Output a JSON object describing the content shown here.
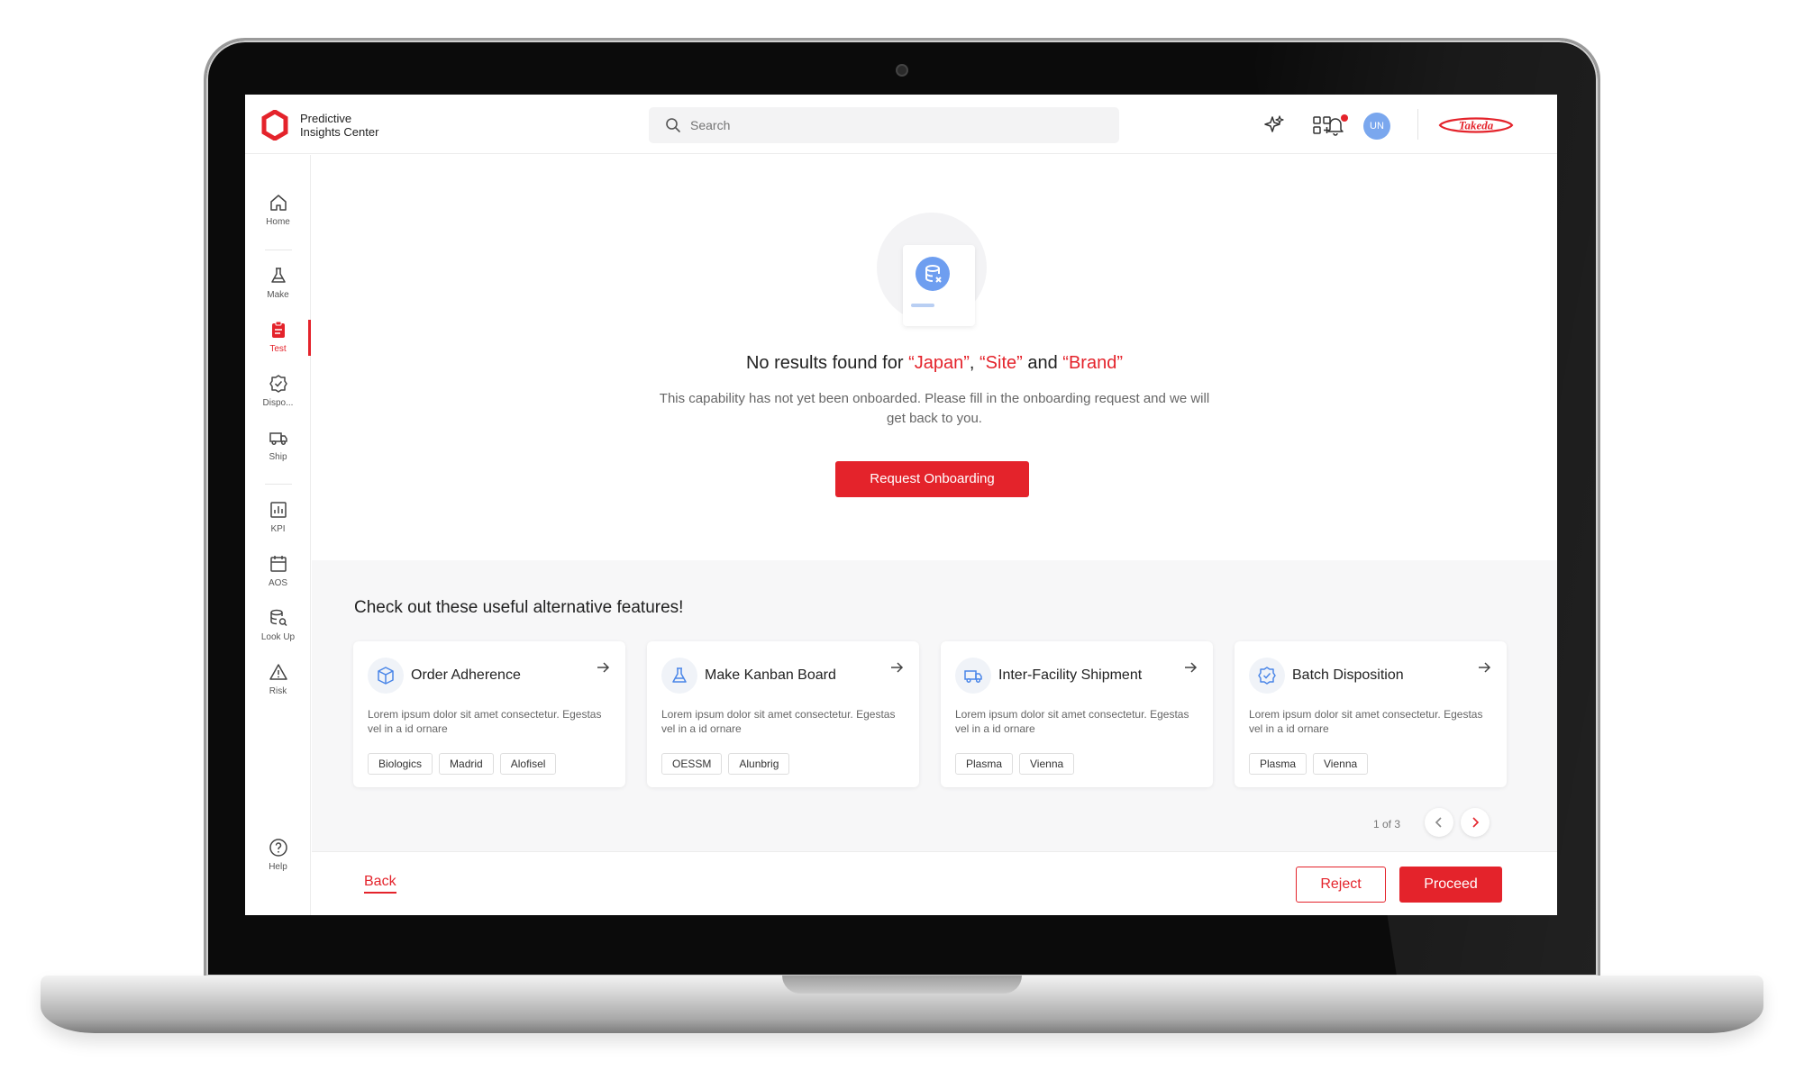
{
  "app": {
    "logo_line1": "Predictive",
    "logo_line2": "Insights Center",
    "brand": "Takeda",
    "search_placeholder": "Search",
    "avatar_initials": "UN",
    "accent_color": "#e4232b",
    "icons": [
      "sparkle-icon",
      "apps-grid-icon",
      "bell-icon"
    ]
  },
  "sidebar": {
    "items": [
      {
        "label": "Home",
        "icon": "home-icon"
      },
      {
        "label": "Make",
        "icon": "flask-icon"
      },
      {
        "label": "Test",
        "icon": "clipboard-icon",
        "active": true
      },
      {
        "label": "Dispo...",
        "icon": "badge-check-icon"
      },
      {
        "label": "Ship",
        "icon": "truck-icon"
      },
      {
        "label": "KPI",
        "icon": "chart-icon"
      },
      {
        "label": "AOS",
        "icon": "calendar-icon"
      },
      {
        "label": "Look Up",
        "icon": "database-search-icon"
      },
      {
        "label": "Risk",
        "icon": "warning-icon"
      }
    ],
    "help_label": "Help"
  },
  "empty_state": {
    "title_prefix": "No results found for ",
    "term1": "“Japan”",
    "sep1": ", ",
    "term2": "“Site”",
    "sep2": " and ",
    "term3": "“Brand”",
    "description": "This capability has not yet been onboarded. Please fill in the onboarding request and we will get back to you.",
    "button": "Request Onboarding"
  },
  "alternatives": {
    "heading": "Check out these useful alternative features!",
    "cards": [
      {
        "title": "Order Adherence",
        "icon": "box-icon",
        "desc": "Lorem ipsum dolor sit amet consectetur. Egestas vel in a id ornare",
        "tags": [
          "Biologics",
          "Madrid",
          "Alofisel"
        ]
      },
      {
        "title": "Make Kanban Board",
        "icon": "flask-icon",
        "desc": "Lorem ipsum dolor sit amet consectetur. Egestas vel in a id ornare",
        "tags": [
          "OESSM",
          "Alunbrig"
        ]
      },
      {
        "title": "Inter-Facility Shipment",
        "icon": "truck-icon",
        "desc": "Lorem ipsum dolor sit amet consectetur. Egestas vel in a id ornare",
        "tags": [
          "Plasma",
          "Vienna"
        ]
      },
      {
        "title": "Batch Disposition",
        "icon": "badge-check-icon",
        "desc": "Lorem ipsum dolor sit amet consectetur. Egestas vel in a id ornare",
        "tags": [
          "Plasma",
          "Vienna"
        ]
      }
    ],
    "pager": "1 of 3"
  },
  "footer": {
    "back": "Back",
    "reject": "Reject",
    "proceed": "Proceed"
  }
}
